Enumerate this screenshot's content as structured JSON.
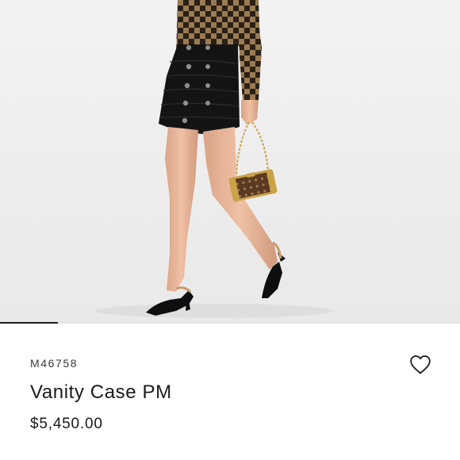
{
  "product": {
    "image_alt": "Model wearing leather skirt carrying Vanity Case PM",
    "sku": "M46758",
    "name": "Vanity Case PM",
    "price": "$5,450.00"
  },
  "gallery": {
    "current_index": 1
  },
  "icons": {
    "wishlist": "heart-outline-icon"
  },
  "colors": {
    "text": "#1a1a1a",
    "indicator_active": "#1a1a1a",
    "indicator_track": "#e3e3e3"
  }
}
